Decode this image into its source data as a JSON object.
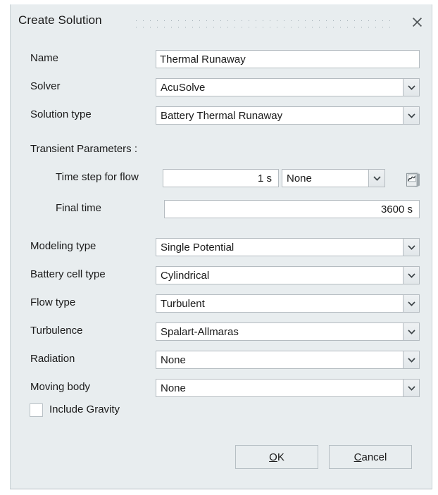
{
  "dialog": {
    "title": "Create Solution",
    "close_icon": "close-icon",
    "grip_icon": "drag-grip-dots"
  },
  "fields": {
    "name": {
      "label": "Name",
      "value": "Thermal Runaway"
    },
    "solver": {
      "label": "Solver",
      "value": "AcuSolve"
    },
    "solution_type": {
      "label": "Solution type",
      "value": "Battery Thermal Runaway"
    },
    "modeling_type": {
      "label": "Modeling type",
      "value": "Single Potential"
    },
    "battery_cell_type": {
      "label": "Battery cell type",
      "value": "Cylindrical"
    },
    "flow_type": {
      "label": "Flow type",
      "value": "Turbulent"
    },
    "turbulence": {
      "label": "Turbulence",
      "value": "Spalart-Allmaras"
    },
    "radiation": {
      "label": "Radiation",
      "value": "None"
    },
    "moving_body": {
      "label": "Moving body",
      "value": "None"
    }
  },
  "transient": {
    "section_label": "Transient Parameters :",
    "time_step": {
      "label": "Time step for flow",
      "value": "1 s",
      "ramp_value": "None",
      "curve_icon": "curve-editor-icon"
    },
    "final_time": {
      "label": "Final time",
      "value": "3600 s"
    }
  },
  "gravity": {
    "label": "Include Gravity",
    "checked": false
  },
  "buttons": {
    "ok": {
      "mnemonic": "O",
      "rest": "K"
    },
    "cancel": {
      "mnemonic": "C",
      "rest": "ancel"
    }
  },
  "colors": {
    "dialog_bg": "#e8edef",
    "field_bg": "#ffffff",
    "field_border": "#b5bcc1",
    "text": "#1a1a1a"
  }
}
